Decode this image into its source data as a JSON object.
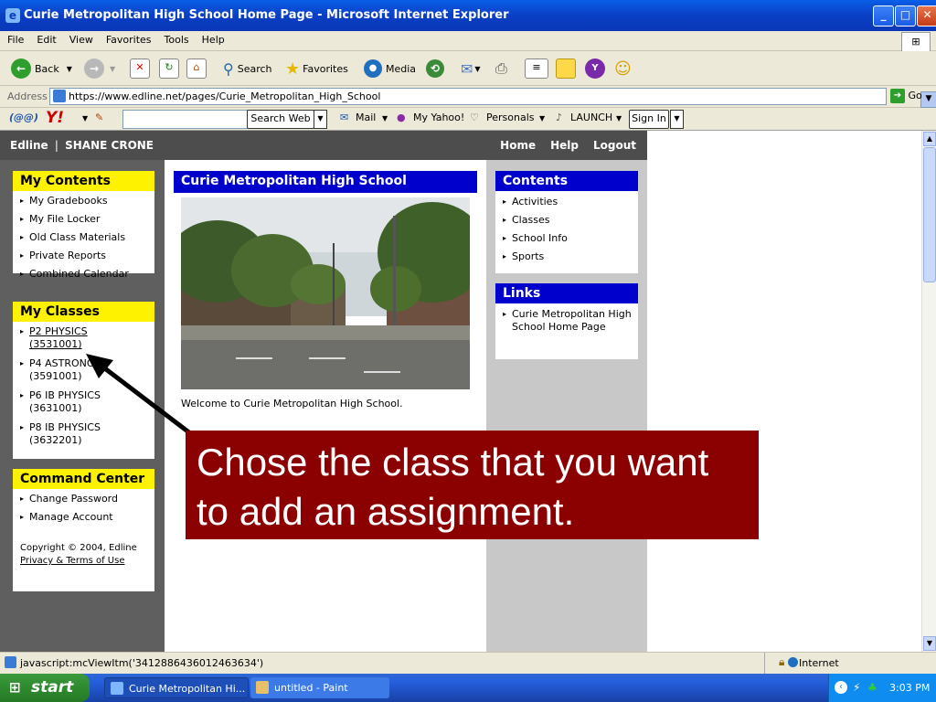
{
  "window": {
    "title": "Curie Metropolitan High School Home Page - Microsoft Internet Explorer"
  },
  "menu": [
    "File",
    "Edit",
    "View",
    "Favorites",
    "Tools",
    "Help"
  ],
  "toolbar": {
    "back": "Back",
    "search": "Search",
    "favorites": "Favorites",
    "media": "Media"
  },
  "address": {
    "label": "Address",
    "url": "https://www.edline.net/pages/Curie_Metropolitan_High_School",
    "go": "Go"
  },
  "yahoo": {
    "search_button": "Search Web",
    "mail": "Mail",
    "myyahoo": "My Yahoo!",
    "personals": "Personals",
    "launch": "LAUNCH",
    "signin": "Sign In"
  },
  "edline": {
    "brand": "Edline",
    "user": "SHANE CRONE",
    "nav": [
      "Home",
      "Help",
      "Logout"
    ]
  },
  "my_contents": {
    "title": "My Contents",
    "items": [
      "My Gradebooks",
      "My File Locker",
      "Old Class Materials",
      "Private Reports",
      "Combined Calendar"
    ]
  },
  "my_classes": {
    "title": "My Classes",
    "items": [
      {
        "name": "P2 PHYSICS",
        "code": "(3531001)"
      },
      {
        "name": "P4 ASTRONOMY",
        "code": "(3591001)"
      },
      {
        "name": "P6 IB PHYSICS",
        "code": "(3631001)"
      },
      {
        "name": "P8 IB PHYSICS",
        "code": "(3632201)"
      }
    ]
  },
  "command_center": {
    "title": "Command Center",
    "items": [
      "Change Password",
      "Manage Account"
    ],
    "copyright": "Copyright © 2004, Edline",
    "privacy": "Privacy & Terms of Use"
  },
  "center": {
    "title": "Curie Metropolitan High School",
    "welcome": "Welcome to Curie Metropolitan High School."
  },
  "contents": {
    "title": "Contents",
    "items": [
      "Activities",
      "Classes",
      "School Info",
      "Sports"
    ]
  },
  "links": {
    "title": "Links",
    "items": [
      "Curie Metropolitan High School Home Page"
    ]
  },
  "callout": {
    "line1": "Chose the class that you want",
    "line2": "to add an assignment."
  },
  "status": {
    "text": "javascript:mcViewItm('3412886436012463634')",
    "zone": "Internet"
  },
  "taskbar": {
    "start": "start",
    "tasks": [
      "Curie Metropolitan Hi...",
      "untitled - Paint"
    ],
    "clock": "3:03 PM"
  },
  "colors": {
    "callout_bg": "#8b0000",
    "box_header_yellow": "#fff200",
    "box_header_blue": "#0000cc"
  }
}
